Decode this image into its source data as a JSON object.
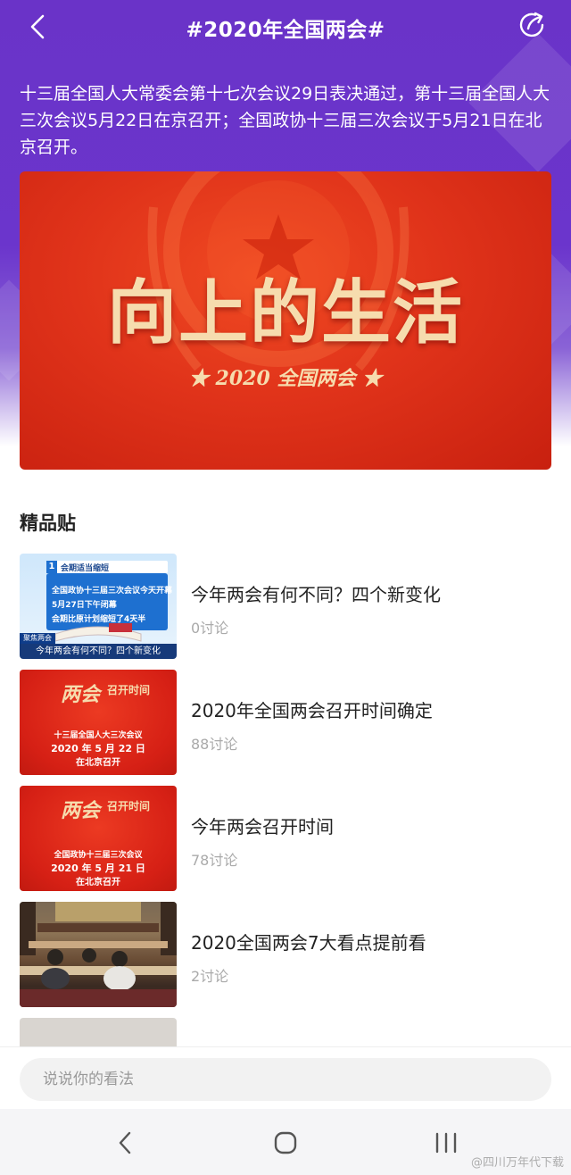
{
  "header": {
    "title": "#2020年全国两会#",
    "back_icon": "chevron-left-icon",
    "share_icon": "share-icon"
  },
  "description": "十三届全国人大常委会第十七次会议29日表决通过，第十三届全国人大三次会议5月22日在京召开；全国政协十三届三次会议于5月21日在北京召开。",
  "banner": {
    "title": "向上的生活",
    "subtitle": "★ 2020 全国两会 ★"
  },
  "section_title": "精品贴",
  "posts": [
    {
      "title": "今年两会有何不同？四个新变化",
      "count": "0讨论",
      "thumb": {
        "header": "会期适当缩短",
        "lines": [
          "全国政协十三届三次会议今天开幕",
          "5月27日下午闭幕",
          "会期比原计划缩短了4天半"
        ],
        "tag": "聚焦两会",
        "caption": "今年两会有何不同？四个新变化"
      }
    },
    {
      "title": "2020年全国两会召开时间确定",
      "count": "88讨论",
      "thumb": {
        "logo": "两会",
        "heading": "召开时间",
        "lines": [
          "十三届全国人大三次会议",
          "2020 年 5 月 22 日",
          "在北京召开"
        ]
      }
    },
    {
      "title": "今年两会召开时间",
      "count": "78讨论",
      "thumb": {
        "logo": "两会",
        "heading": "召开时间",
        "lines": [
          "全国政协十三届三次会议",
          "2020 年 5 月 21 日",
          "在北京召开"
        ]
      }
    },
    {
      "title": "2020全国两会7大看点提前看",
      "count": "2讨论"
    }
  ],
  "comment": {
    "placeholder": "说说你的看法"
  },
  "navbar": {
    "back_icon": "back-icon",
    "home_icon": "home-icon",
    "recents_icon": "recents-icon"
  },
  "watermark": "@四川万年代下载"
}
